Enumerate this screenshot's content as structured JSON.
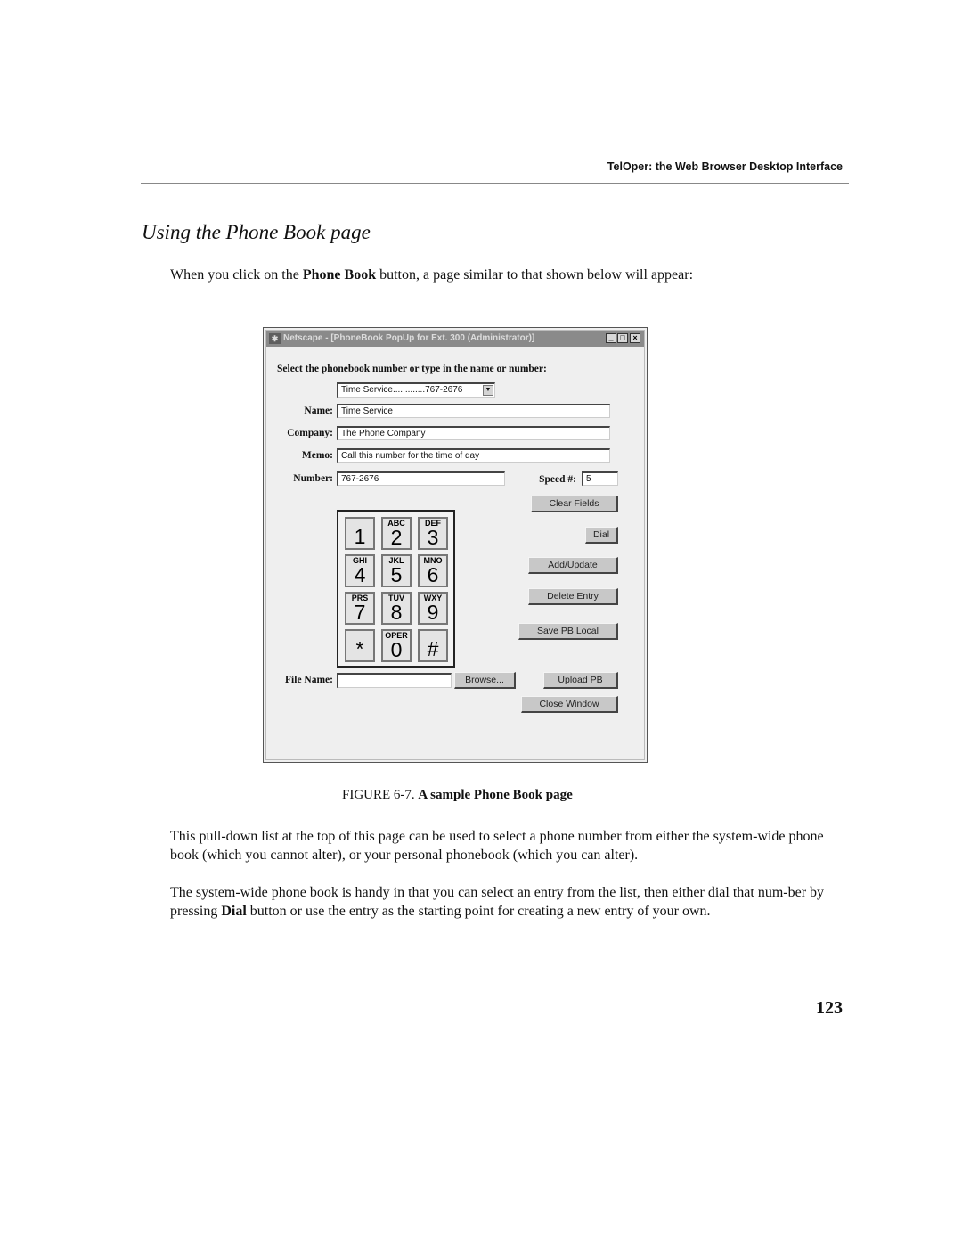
{
  "page": {
    "running_header": "TelOper: the Web Browser Desktop Interface",
    "section_title": "Using the Phone Book page",
    "intro": {
      "before": "When you click on the ",
      "bold": "Phone Book",
      "after": " button, a page similar to that shown below will appear:"
    },
    "caption": {
      "prefix": "FIGURE 6-7. ",
      "bold": "A sample Phone Book page"
    },
    "paragraph1": "This pull-down list at the top of this page can be used to select a phone number from either the system-wide phone book (which you cannot alter), or your personal phonebook (which you can alter).",
    "paragraph2": {
      "before": "The system-wide phone book is handy in that you can select an entry from the list, then either dial that num-ber by pressing ",
      "bold": "Dial",
      "after": " button or use the entry as the starting point for creating a new entry of your own."
    },
    "page_number": "123"
  },
  "window": {
    "title": "Netscape - [PhoneBook PopUp for Ext. 300 (Administrator)]",
    "app_icon": "netscape-icon",
    "controls": {
      "minimize": "_",
      "maximize": "□",
      "close": "×"
    },
    "instruction": "Select the phonebook number or type in the name or number:",
    "phonebook_select": {
      "value": "Time Service.............767-2676",
      "arrow": "▼"
    },
    "labels": {
      "name": "Name:",
      "company": "Company:",
      "memo": "Memo:",
      "number": "Number:",
      "speed": "Speed #:",
      "file_name": "File Name:"
    },
    "fields": {
      "name": "Time Service",
      "company": "The Phone Company",
      "memo": "Call this number for the time of day",
      "number": "767-2676",
      "speed": "5",
      "file_name": ""
    },
    "keypad": [
      {
        "digit": "1",
        "letters": ""
      },
      {
        "digit": "2",
        "letters": "ABC"
      },
      {
        "digit": "3",
        "letters": "DEF"
      },
      {
        "digit": "4",
        "letters": "GHI"
      },
      {
        "digit": "5",
        "letters": "JKL"
      },
      {
        "digit": "6",
        "letters": "MNO"
      },
      {
        "digit": "7",
        "letters": "PRS"
      },
      {
        "digit": "8",
        "letters": "TUV"
      },
      {
        "digit": "9",
        "letters": "WXY"
      },
      {
        "digit": "*",
        "letters": ""
      },
      {
        "digit": "0",
        "letters": "OPER"
      },
      {
        "digit": "#",
        "letters": ""
      }
    ],
    "buttons": {
      "clear_fields": "Clear Fields",
      "dial": "Dial",
      "add_update": "Add/Update",
      "delete_entry": "Delete Entry",
      "save_pb_local": "Save PB Local",
      "browse": "Browse...",
      "upload_pb": "Upload PB",
      "close_window": "Close Window"
    }
  }
}
